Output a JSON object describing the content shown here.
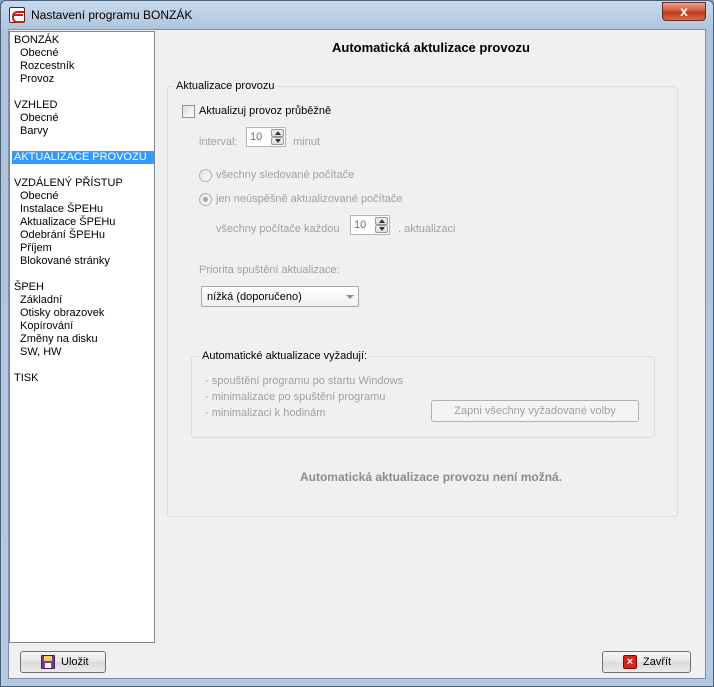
{
  "window": {
    "title": "Nastavení programu BONZÁK",
    "close_glyph": "x"
  },
  "tree": {
    "items": [
      {
        "label": "BONZÁK",
        "level": 0
      },
      {
        "label": "Obecné",
        "level": 1
      },
      {
        "label": "Rozcestník",
        "level": 1
      },
      {
        "label": "Provoz",
        "level": 1
      },
      {
        "label": "VZHLED",
        "level": 0
      },
      {
        "label": "Obecné",
        "level": 1
      },
      {
        "label": "Barvy",
        "level": 1
      },
      {
        "label": "AKTUALIZACE PROVOZU",
        "level": 0,
        "selected": true
      },
      {
        "label": "VZDÁLENÝ PŘÍSTUP",
        "level": 0
      },
      {
        "label": "Obecné",
        "level": 1
      },
      {
        "label": "Instalace ŠPEHu",
        "level": 1
      },
      {
        "label": "Aktualizace ŠPEHu",
        "level": 1
      },
      {
        "label": "Odebrání ŠPEHu",
        "level": 1
      },
      {
        "label": "Příjem",
        "level": 1
      },
      {
        "label": "Blokované stránky",
        "level": 1
      },
      {
        "label": "ŠPEH",
        "level": 0
      },
      {
        "label": "Základní",
        "level": 1
      },
      {
        "label": "Otisky obrazovek",
        "level": 1
      },
      {
        "label": "Kopírování",
        "level": 1
      },
      {
        "label": "Změny na disku",
        "level": 1
      },
      {
        "label": "SW, HW",
        "level": 1
      },
      {
        "label": "TISK",
        "level": 0
      }
    ]
  },
  "panel": {
    "title": "Automatická aktulizace provozu",
    "group_label": "Aktualizace provozu",
    "auto_update_checkbox_label": "Aktualizuj provoz průběžně",
    "auto_update_checked": false,
    "interval_label": "interval:",
    "interval_value": "10",
    "interval_unit": "minut",
    "radio_all_label": "všechny sledované počítače",
    "radio_failed_label": "jen neúspěšně aktualizované počítače",
    "radio_selected": "failed",
    "every_label": "všechny počítače každou",
    "every_value": "10",
    "every_unit": ". aktualizaci",
    "priority_label": "Priorita spuštění aktualizace:",
    "priority_value": "nížká (doporučeno)",
    "requirements": {
      "label": "Automatické aktualizace vyžadují:",
      "items": [
        "- spouštění programu po startu Windows",
        "- minimalizace po spuštění programu",
        "- minimalizaci k hodinám"
      ],
      "enable_button_label": "Zapni všechny vyžadované volby"
    },
    "status_message": "Automatická aktualizace provozu není možná."
  },
  "footer": {
    "save_label": "Uložit",
    "close_label": "Zavřít"
  }
}
